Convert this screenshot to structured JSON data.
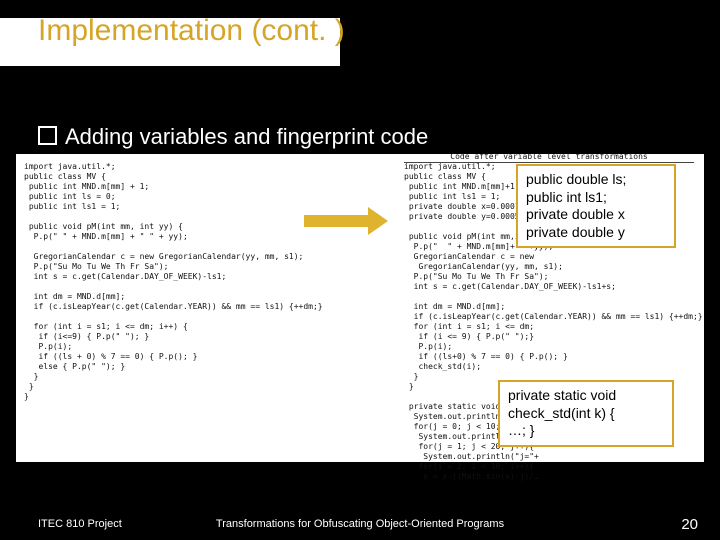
{
  "title": "Implementation (cont. )",
  "bullet": "Adding variables and fingerprint code",
  "rightHeader": "Code after variable level transformations",
  "codeLeft": "import java.util.*;\npublic class MV {\n public int MND.m[mm] + 1;\n public int ls = 0;\n public int ls1 = 1;\n\n public void pM(int mm, int yy) {\n  P.p(\" \" + MND.m[mm] + \" \" + yy);\n\n  GregorianCalendar c = new GregorianCalendar(yy, mm, s1);\n  P.p(\"Su Mo Tu We Th Fr Sa\");\n  int s = c.get(Calendar.DAY_OF_WEEK)-ls1;\n\n  int dm = MND.d[mm];\n  if (c.isLeapYear(c.get(Calendar.YEAR)) && mm == ls1) {++dm;}\n\n  for (int i = s1; i <= dm; i++) {\n   if (i<=9) { P.p(\" \"); }\n   P.p(i);\n   if ((ls + 0) % 7 == 0) { P.p(); }\n   else { P.p(\" \"); }\n  }\n }\n}",
  "codeRight": "import java.util.*;\npublic class MV {\n public int MND.m[mm]+1;\n public int ls1 = 1;\n private double x=0.0001;\n private double y=0.0005;\n\n public void pM(int mm,int yy) {\n  P.p(\"  \" + MND.m[mm]+\" \"+yy);\n  GregorianCalendar c = new\n   GregorianCalendar(yy, mm, s1);\n  P.p(\"Su Mo Tu We Th Fr Sa\");\n  int s = c.get(Calendar.DAY_OF_WEEK)-ls1+s;\n\n  int dm = MND.d[mm];\n  if (c.isLeapYear(c.get(Calendar.YEAR)) && mm == ls1) {++dm;}\n  for (int i = s1; i <= dm;\n   if (i <= 9) { P.p(\" \");}\n   P.p(i);\n   if ((ls+0) % 7 == 0) { P.p(); }\n   check_std(i);\n  }\n }\n\n private static void check_std(int k) {\n  System.out.println(\"k=\"+k+\"10+\n  for(j = 0; j < 10; j++){\n   System.out.println(\"j=\"+j+…\n   for(j = 1; j < 20; j++){\n    System.out.println(\"j=\"+\n   for(i = 2; i < 10; i++){\n    x = x-((Math.sin(x)-j)/…\n",
  "callout1": {
    "l1": "public double ls;",
    "l2": "public int ls1;",
    "l3": "private double x",
    "l4": "private double y"
  },
  "callout2": {
    "l1": "private static void",
    "l2": "check_std(int k) {",
    "l3": "…; }"
  },
  "footer": {
    "left": "ITEC 810 Project",
    "center": "Transformations for Obfuscating Object-Oriented Programs",
    "right": "20"
  }
}
